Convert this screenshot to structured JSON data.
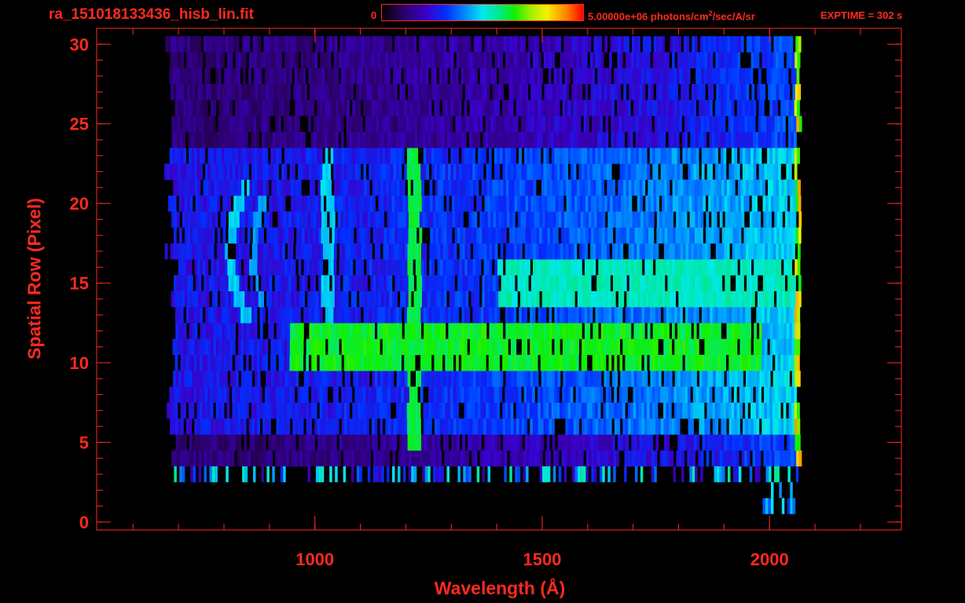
{
  "header": {
    "file_title": "ra_151018133436_hisb_lin.fit",
    "colorbar_min": "0",
    "colorbar_max_value": "5.00000e+06 photons/cm",
    "colorbar_max_exp": "2",
    "colorbar_max_units": "/sec/A/sr",
    "exptime": "EXPTIME = 302 s"
  },
  "colors": {
    "axis": "#ff2a1f",
    "background": "#000000"
  },
  "chart_data": {
    "type": "heatmap",
    "title": "ra_151018133436_hisb_lin.fit",
    "xlabel": "Wavelength (Å)",
    "ylabel": "Spatial Row (Pixel)",
    "xlim": [
      520,
      2290
    ],
    "ylim": [
      -0.5,
      31
    ],
    "x_ticks": [
      1000,
      1500,
      2000
    ],
    "x_tick_labels": [
      "1000",
      "1500",
      "2000"
    ],
    "x_minor_step": 100,
    "y_ticks": [
      0,
      5,
      10,
      15,
      20,
      25,
      30
    ],
    "y_tick_labels": [
      "0",
      "5",
      "10",
      "15",
      "20",
      "25",
      "30"
    ],
    "y_minor_step": 1,
    "colorbar": {
      "min": 0,
      "max": 5000000,
      "units": "photons/cm^2/sec/A/sr",
      "colormap": "rainbow"
    },
    "grid": false,
    "spectral_range": [
      680,
      2065
    ],
    "spatial_rows": [
      4,
      30
    ],
    "features": [
      {
        "kind": "emission_line",
        "wavelength": 1216,
        "rows": [
          5,
          23
        ],
        "intensity": 0.6
      },
      {
        "kind": "emission_line",
        "wavelength": 1026,
        "rows": [
          11,
          23
        ],
        "intensity": 0.45
      },
      {
        "kind": "arc",
        "wavelength_at_center": 810,
        "row_center": 17,
        "rows": [
          13,
          21
        ],
        "intensity": 0.45
      },
      {
        "kind": "arc",
        "wavelength_at_center": 860,
        "row_center": 17,
        "rows": [
          14,
          20
        ],
        "intensity": 0.4
      },
      {
        "kind": "continuum_band",
        "rows": [
          10,
          12
        ],
        "wavelength_range": [
          940,
          1980
        ],
        "intensity": 0.65
      },
      {
        "kind": "continuum_band",
        "rows": [
          14,
          16
        ],
        "wavelength_range": [
          1400,
          2060
        ],
        "intensity": 0.55
      },
      {
        "kind": "edge_band",
        "wavelength": 2060,
        "rows": [
          2,
          30
        ],
        "intensity": 0.9
      }
    ]
  }
}
